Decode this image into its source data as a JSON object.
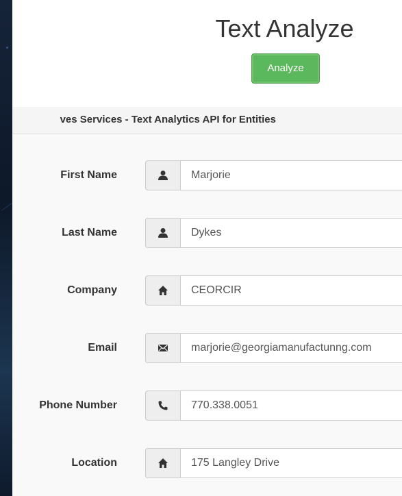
{
  "app": {
    "title": "Text Analyze",
    "analyze_button": "Analyze"
  },
  "section": {
    "header": "ves Services - Text Analytics API for Entities"
  },
  "form": {
    "fields": [
      {
        "label": "First Name",
        "value": "Marjorie",
        "icon": "user-icon"
      },
      {
        "label": "Last Name",
        "value": "Dykes",
        "icon": "user-icon"
      },
      {
        "label": "Company",
        "value": "CEORCIR",
        "icon": "home-icon"
      },
      {
        "label": "Email",
        "value": "marjorie@georgiamanufactunng.com",
        "icon": "envelope-icon"
      },
      {
        "label": "Phone Number",
        "value": "770.338.0051",
        "icon": "phone-icon"
      },
      {
        "label": "Location",
        "value": "175 Langley Drive",
        "icon": "home-icon"
      }
    ]
  },
  "colors": {
    "button": "#5cb85c",
    "background": "#0f1b2e",
    "addon": "#eeeeee"
  }
}
